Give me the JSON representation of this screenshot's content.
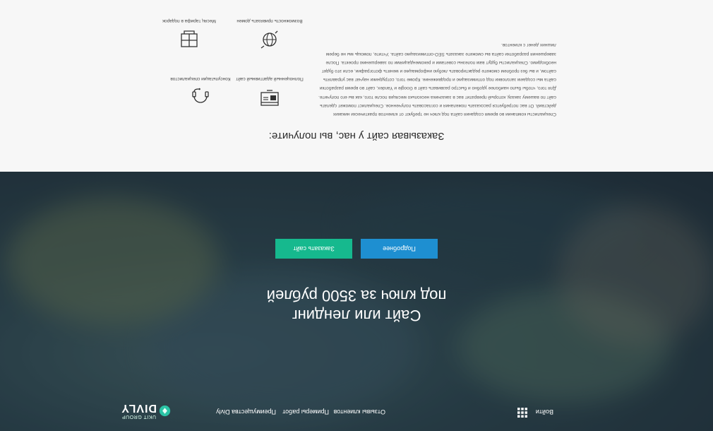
{
  "nav": {
    "logo_text": "DIVLY",
    "logo_sub": "UKIT GROUP",
    "links": [
      "Преимущества Divly",
      "Примеры работ",
      "Отзывы клиентов"
    ],
    "login": "Войти",
    "apps_icon": "grid-icon"
  },
  "hero": {
    "title_line1": "Сайт или лендинг",
    "title_line2": "под ключ за 3500 рублей",
    "btn_order": "Заказать сайт",
    "btn_more": "Подробнее",
    "colors": {
      "order": "#16b98e",
      "more": "#1e8fd1"
    }
  },
  "benefits": {
    "title": "Заказывая сайт у нас, вы получите:",
    "text": "Специалисты компании во время создания сайта под ключ не требуют от клиентов практически никаких действий. От вас потребуется рассказать пожелания и согласовать полученное. Специалист поможет сделать сайт по вашему заказу, который превратит вас в заказчика несколько месяцев после того, как вы его получите. Для того, чтобы было наиболее удобно и быстро развивать сайт в Google и Yandex, сайт во время разработки сайта мы создаем заголовки под оптимизацию и продвижение. Кроме того, сотрудники научат вас управлять сайтом, и вы без проблем сможете редактировать любую информацию и менять фотографии, если это будет необходимо. Специалисты будут вам полезны советами и рекомендациями по завершению проекта. После завершения разработки сайта вы сможете заказать SEO-оптимизацию сайта. Учтите, помощь мы не берем лишних денег с клиентов.",
    "features": [
      {
        "icon": "headset-icon",
        "label": "Консультации специалистов"
      },
      {
        "icon": "monitor-tools-icon",
        "label": "Полноценный адаптивный сайт"
      },
      {
        "icon": "window-icon",
        "label": "Месяц тарифа в подарок"
      },
      {
        "icon": "globe-icon",
        "label": "Возможность привязать домен"
      }
    ]
  }
}
